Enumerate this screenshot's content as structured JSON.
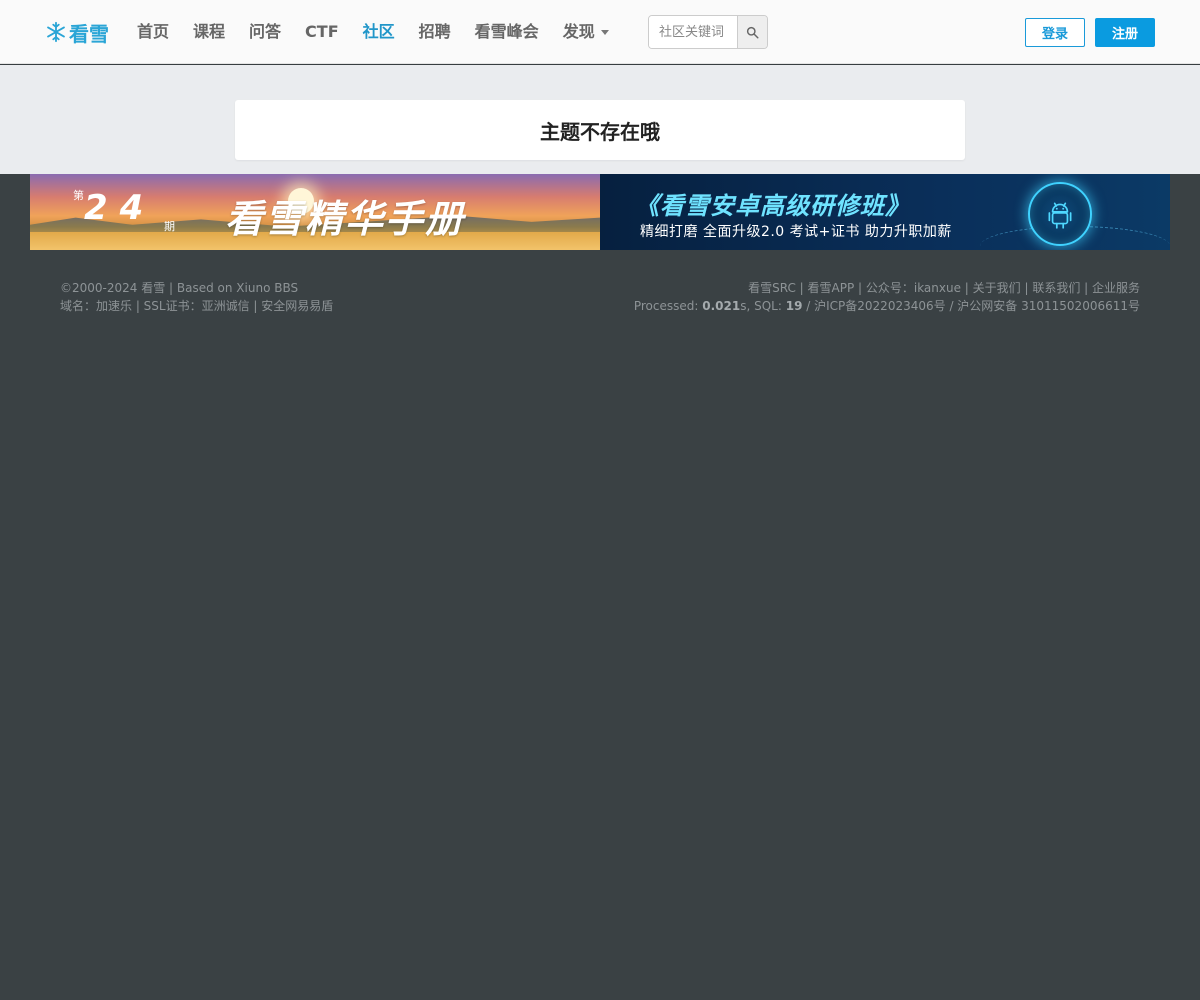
{
  "header": {
    "logo_text": "看雪",
    "nav": [
      {
        "label": "首页",
        "active": false
      },
      {
        "label": "课程",
        "active": false
      },
      {
        "label": "问答",
        "active": false
      },
      {
        "label": "CTF",
        "active": false
      },
      {
        "label": "社区",
        "active": true
      },
      {
        "label": "招聘",
        "active": false
      },
      {
        "label": "看雪峰会",
        "active": false
      }
    ],
    "more_label": "发现",
    "search_placeholder": "社区关键词",
    "login_label": "登录",
    "register_label": "注册",
    "accent_color": "#2196c9"
  },
  "main": {
    "notice": "主题不存在哦"
  },
  "banners": {
    "left": {
      "issue_prefix": "第",
      "issue_number": "24",
      "issue_suffix": "期",
      "title": "看雪精华手册"
    },
    "right": {
      "title": "《看雪安卓高级研修班》",
      "subtitle": "精细打磨  全面升级2.0   考试+证书  助力升职加薪"
    }
  },
  "footer": {
    "copyright": "©2000-2024 看雪 | Based on Xiuno BBS",
    "domain_line": "域名：加速乐 | SSL证书：亚洲诚信 | 安全网易易盾",
    "links_line": "看雪SRC | 看雪APP | 公众号：ikanxue | 关于我们 | 联系我们 | 企业服务",
    "processed_label": "Processed:",
    "processed_time": "0.021",
    "processed_unit": "s, SQL:",
    "sql_count": "19",
    "icp": "/ 沪ICP备2022023406号 / 沪公网安备 31011502006611号"
  }
}
